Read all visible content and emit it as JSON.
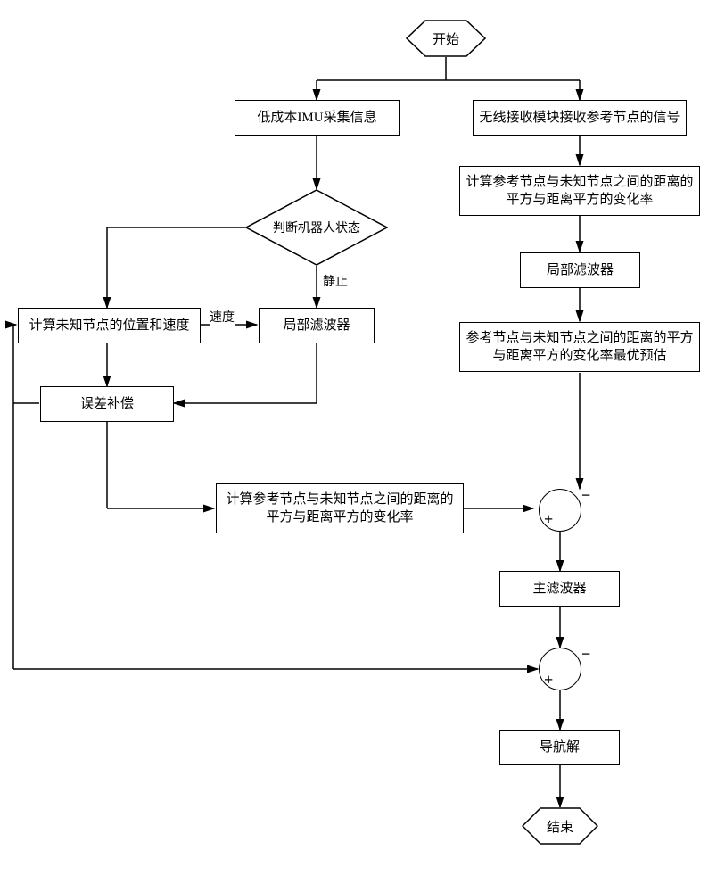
{
  "nodes": {
    "start": "开始",
    "imu": "低成本IMU采集信息",
    "state": "判断机器人状态",
    "pv": "计算未知节点的位置和速度",
    "lf_left": "局部滤波器",
    "err": "误差补偿",
    "calc_left": "计算参考节点与未知节点之间的距离的平方与距离平方的变化率",
    "rx": "无线接收模块接收参考节点的信号",
    "calc_right": "计算参考节点与未知节点之间的距离的平方与距离平方的变化率",
    "lf_right": "局部滤波器",
    "opt": "参考节点与未知节点之间的距离的平方与距离平方的变化率最优预估",
    "main": "主滤波器",
    "nav": "导航解",
    "end": "结束"
  },
  "edgeLabels": {
    "speed": "速度",
    "still": "静止"
  },
  "signs": {
    "plus": "+",
    "minus": "−"
  }
}
